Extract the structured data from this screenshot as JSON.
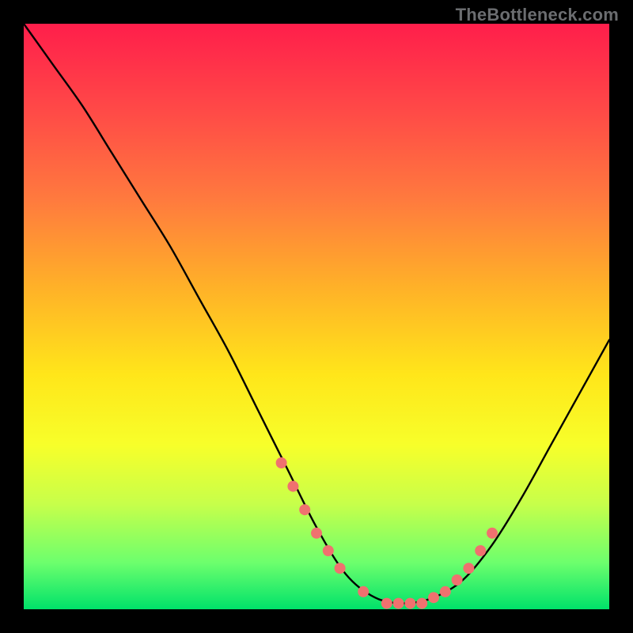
{
  "watermark": "TheBottleneck.com",
  "chart_data": {
    "type": "line",
    "title": "",
    "xlabel": "",
    "ylabel": "",
    "xlim": [
      0,
      100
    ],
    "ylim": [
      0,
      100
    ],
    "series": [
      {
        "name": "curve",
        "x": [
          0,
          5,
          10,
          15,
          20,
          25,
          30,
          35,
          40,
          45,
          50,
          55,
          60,
          65,
          70,
          75,
          80,
          85,
          90,
          95,
          100
        ],
        "y": [
          100,
          93,
          86,
          78,
          70,
          62,
          53,
          44,
          34,
          24,
          14,
          6,
          2,
          1,
          2,
          5,
          11,
          19,
          28,
          37,
          46
        ]
      }
    ],
    "markers": {
      "name": "highlight-dots",
      "color": "#f0716f",
      "x": [
        44,
        46,
        48,
        50,
        52,
        54,
        58,
        62,
        64,
        66,
        68,
        70,
        72,
        74,
        76,
        78,
        80
      ],
      "y": [
        25,
        21,
        17,
        13,
        10,
        7,
        3,
        1,
        1,
        1,
        1,
        2,
        3,
        5,
        7,
        10,
        13
      ]
    }
  }
}
